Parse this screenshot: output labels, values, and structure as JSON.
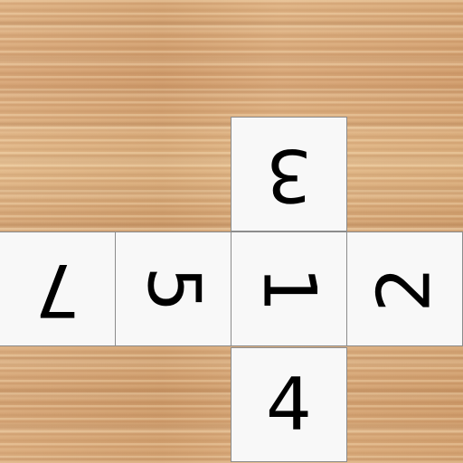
{
  "tiles": [
    {
      "id": "t3",
      "label": "3",
      "orientation": "upside-down"
    },
    {
      "id": "t7",
      "label": "7",
      "orientation": "upside-down"
    },
    {
      "id": "t5",
      "label": "5",
      "orientation": "rotated-clockwise"
    },
    {
      "id": "t1",
      "label": "1",
      "orientation": "rotated-clockwise"
    },
    {
      "id": "t2",
      "label": "2",
      "orientation": "rotated-counterclockwise"
    },
    {
      "id": "t4",
      "label": "4",
      "orientation": "upright"
    }
  ],
  "colors": {
    "board_wood": "#d9a877",
    "tile_face": "#f8f8f8",
    "tile_border": "#8c8c8c",
    "digit": "#000000"
  }
}
